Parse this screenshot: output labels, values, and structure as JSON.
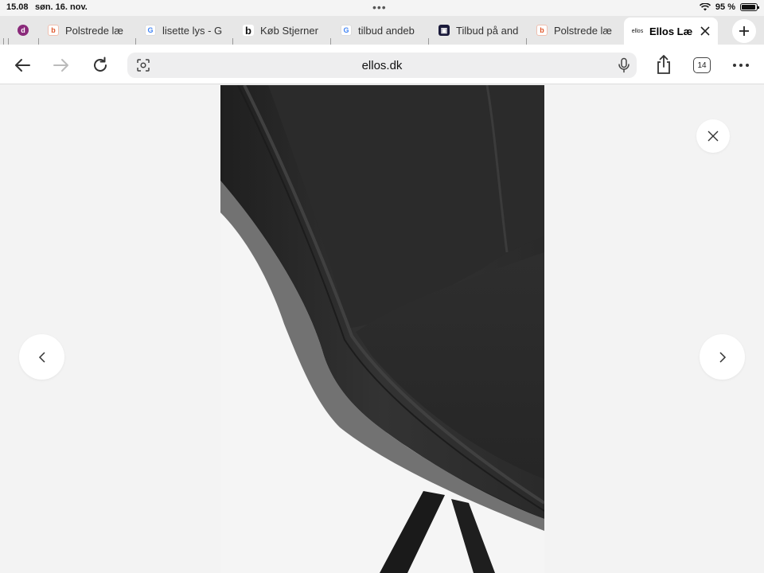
{
  "status": {
    "time": "15.08",
    "date": "søn. 16. nov.",
    "battery": "95 %",
    "battery_level": 0.95
  },
  "tabs": [
    {
      "label": "Polstrede læ",
      "icon": "bilka-icon",
      "color": "#e0562a"
    },
    {
      "label": "lisette lys - G",
      "icon": "google-icon",
      "color": "#4285f4"
    },
    {
      "label": "Køb Stjerner",
      "icon": "b-icon",
      "color": "#222222"
    },
    {
      "label": "tilbud andeb",
      "icon": "google-icon",
      "color": "#4285f4"
    },
    {
      "label": "Tilbud på and",
      "icon": "bag-icon",
      "color": "#1a1a3a"
    },
    {
      "label": "Polstrede læ",
      "icon": "bilka-icon",
      "color": "#e0562a"
    },
    {
      "label": "Ellos Læ",
      "icon": "ellos-icon",
      "active": true
    }
  ],
  "toolbar": {
    "url": "ellos.dk",
    "tab_count": "14"
  },
  "viewer": {
    "prev_label": "‹",
    "next_label": "›",
    "close_label": "×"
  },
  "colors": {
    "accent": "#ffffff",
    "background": "#f3f3f3",
    "chair": "#2a2a2a"
  }
}
